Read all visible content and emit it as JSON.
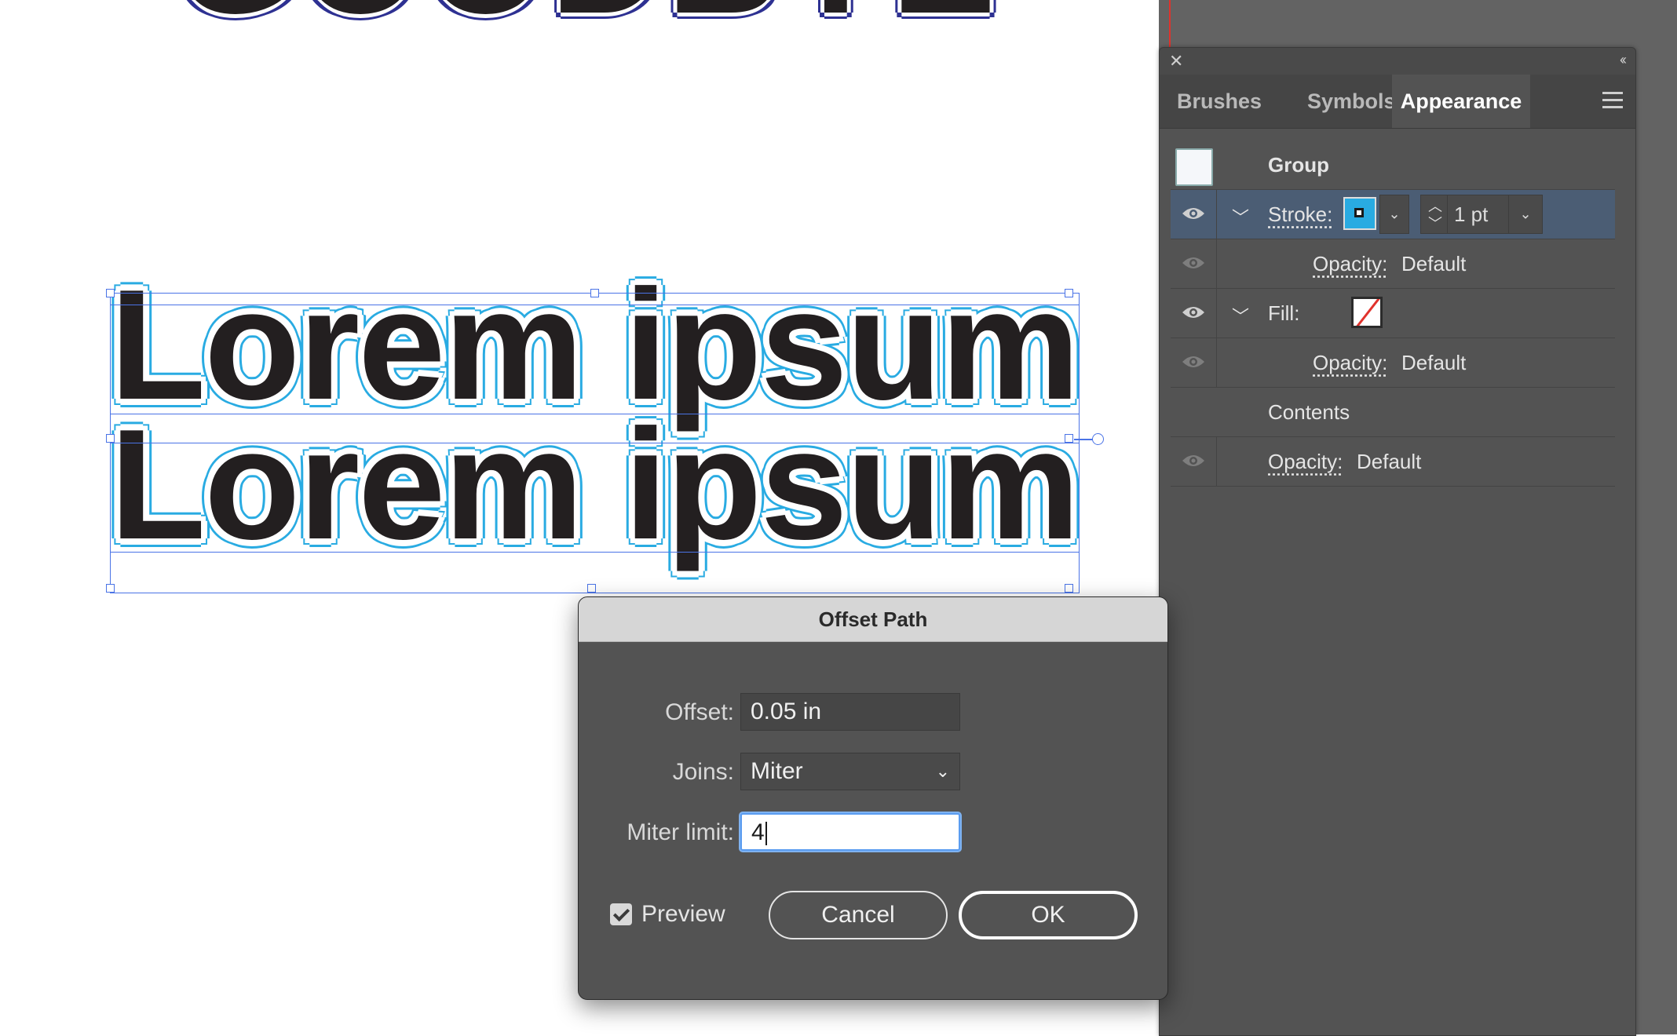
{
  "canvas": {
    "partial_text": "GOODBYE",
    "artwork_lines": [
      "Lorem ipsum",
      "Lorem ipsum"
    ],
    "stroke_color": "#29abe2",
    "selection_color": "#4a73e6"
  },
  "panel": {
    "tabs": [
      {
        "label": "Brushes",
        "active": false
      },
      {
        "label": "Symbols",
        "active": false
      },
      {
        "label": "Appearance",
        "active": true
      }
    ],
    "group_label": "Group",
    "stroke": {
      "label": "Stroke:",
      "weight": "1 pt",
      "color": "#29abe2"
    },
    "stroke_opacity": {
      "label": "Opacity:",
      "value": "Default"
    },
    "fill": {
      "label": "Fill:",
      "swatch": "none"
    },
    "fill_opacity": {
      "label": "Opacity:",
      "value": "Default"
    },
    "contents_label": "Contents",
    "opacity": {
      "label": "Opacity:",
      "value": "Default"
    }
  },
  "dialog": {
    "title": "Offset Path",
    "offset": {
      "label": "Offset:",
      "value": "0.05 in"
    },
    "joins": {
      "label": "Joins:",
      "value": "Miter"
    },
    "miter_limit": {
      "label": "Miter limit:",
      "value": "4"
    },
    "preview": {
      "label": "Preview",
      "checked": true
    },
    "cancel_label": "Cancel",
    "ok_label": "OK"
  }
}
